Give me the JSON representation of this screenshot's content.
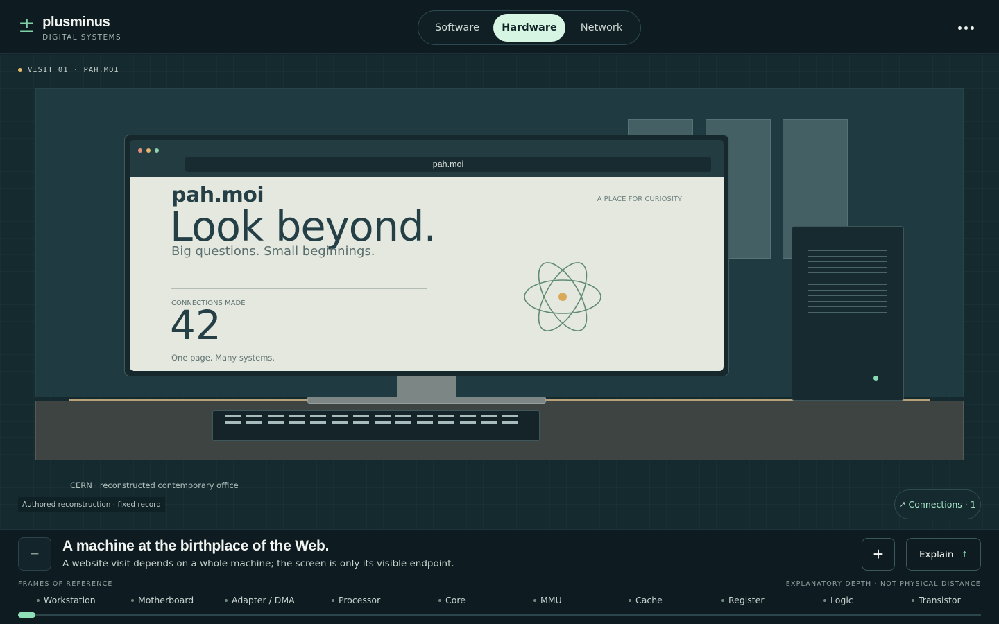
{
  "brand": {
    "mark": "±",
    "name": "plusminus",
    "subtitle": "DIGITAL SYSTEMS"
  },
  "nav": {
    "tabs": [
      "Software",
      "Hardware",
      "Network"
    ],
    "active": "Hardware"
  },
  "menu": {
    "icon": "more-horizontal-icon"
  },
  "visit": {
    "label": "VISIT 01 · PAH.MOI"
  },
  "browser": {
    "url": "pah.moi",
    "dot_colors": [
      "#e2907a",
      "#e0b86a",
      "#8fd3ad"
    ]
  },
  "website": {
    "site_name": "pah.moi",
    "headline": "Look beyond.",
    "tagline": "Big questions. Small beginnings.",
    "kicker": "A PLACE FOR CURIOSITY",
    "connections_label": "CONNECTIONS MADE",
    "connections_value": "42",
    "footnote": "One page. Many systems."
  },
  "scene": {
    "caption": "CERN · reconstructed contemporary office",
    "record": "Authored reconstruction · fixed record"
  },
  "connections_button": {
    "arrow": "↗",
    "label": "Connections · 1"
  },
  "info": {
    "title": "A machine at the birthplace of the Web.",
    "subtitle": "A website visit depends on a whole machine; the screen is only its visible endpoint."
  },
  "controls": {
    "zoom_out": "−",
    "zoom_in": "+",
    "explain_label": "Explain",
    "explain_arrow": "↑"
  },
  "frames": {
    "label": "FRAMES OF REFERENCE",
    "depth_note": "EXPLANATORY DEPTH · NOT PHYSICAL DISTANCE",
    "items": [
      "Workstation",
      "Motherboard",
      "Adapter / DMA",
      "Processor",
      "Core",
      "MMU",
      "Cache",
      "Register",
      "Logic",
      "Transistor"
    ],
    "current_index": 0
  },
  "colors": {
    "accent": "#8fe0b9",
    "active_tab_bg": "#d7f5e3",
    "screen_bg": "#e5e8df",
    "atom_nucleus": "#d8aa58"
  }
}
